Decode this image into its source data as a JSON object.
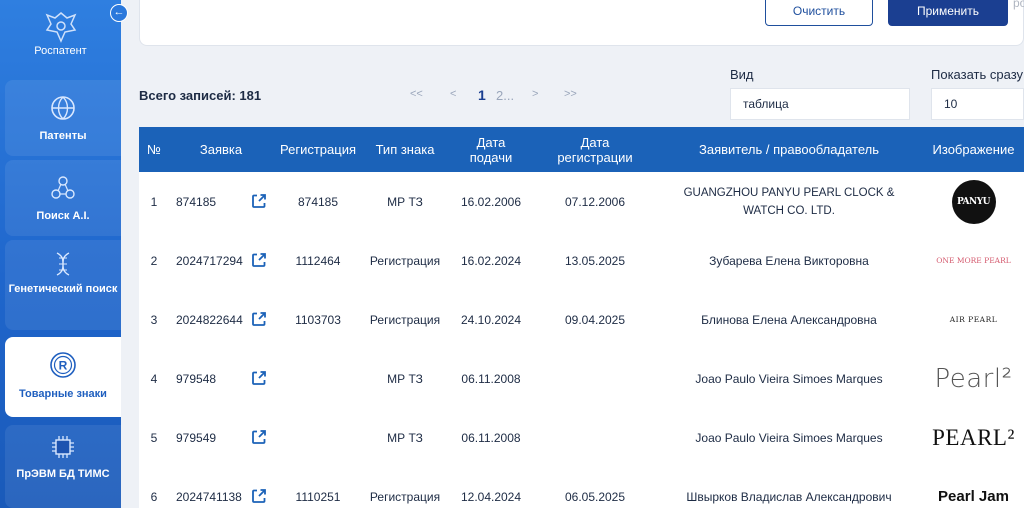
{
  "sidebar": {
    "logo_text": "Роспатент",
    "items": [
      {
        "label": "Патенты",
        "icon": "globe-icon"
      },
      {
        "label": "Поиск A.I.",
        "icon": "ai-network-icon"
      },
      {
        "label": "Генетический поиск",
        "icon": "dna-icon"
      },
      {
        "label": "Товарные знаки",
        "icon": "registered-trademark-icon"
      },
      {
        "label": "ПрЭВМ БД ТИМС",
        "icon": "chip-icon"
      }
    ]
  },
  "top": {
    "clear_label": "Очистить",
    "apply_label": "Применить",
    "cut_text": "ро"
  },
  "summary": {
    "total_label": "Всего записей: 181"
  },
  "pagination": {
    "first": "<<",
    "prev": "<",
    "current": "1",
    "other": "2...",
    "next": ">",
    "last": ">>"
  },
  "view": {
    "label": "Вид",
    "value": "таблица"
  },
  "page_size": {
    "label": "Показать сразу",
    "value": "10"
  },
  "table": {
    "columns": [
      "№",
      "Заявка",
      "Регистрация",
      "Тип знака",
      "Дата подачи",
      "Дата регистрации",
      "Заявитель / правообладатель",
      "Изображение"
    ],
    "rows": [
      {
        "num": "1",
        "app": "874185",
        "reg": "874185",
        "type": "МР ТЗ",
        "filed": "16.02.2006",
        "registered": "07.12.2006",
        "owner": "GUANGZHOU PANYU PEARL CLOCK & WATCH CO. LTD.",
        "image_text": "PANYU"
      },
      {
        "num": "2",
        "app": "2024717294",
        "reg": "1112464",
        "type": "Регистрация",
        "filed": "16.02.2024",
        "registered": "13.05.2025",
        "owner": "Зубарева Елена Викторовна",
        "image_text": "ONE MORE PEARL"
      },
      {
        "num": "3",
        "app": "2024822644",
        "reg": "1103703",
        "type": "Регистрация",
        "filed": "24.10.2024",
        "registered": "09.04.2025",
        "owner": "Блинова Елена Александровна",
        "image_text": "AIR PEARL"
      },
      {
        "num": "4",
        "app": "979548",
        "reg": "",
        "type": "МР ТЗ",
        "filed": "06.11.2008",
        "registered": "",
        "owner": "Joao Paulo Vieira Simoes Marques",
        "image_text": "Pearl²"
      },
      {
        "num": "5",
        "app": "979549",
        "reg": "",
        "type": "МР ТЗ",
        "filed": "06.11.2008",
        "registered": "",
        "owner": "Joao Paulo Vieira Simoes Marques",
        "image_text": "PEARL²"
      },
      {
        "num": "6",
        "app": "2024741138",
        "reg": "1110251",
        "type": "Регистрация",
        "filed": "12.04.2024",
        "registered": "06.05.2025",
        "owner": "Швырков Владислав Александрович",
        "image_text": "Pearl Jam"
      }
    ]
  },
  "colors": {
    "sidebar": "#2470d6",
    "header": "#1b62b8",
    "apply": "#1b3f91",
    "link_icon": "#1b62b8"
  }
}
